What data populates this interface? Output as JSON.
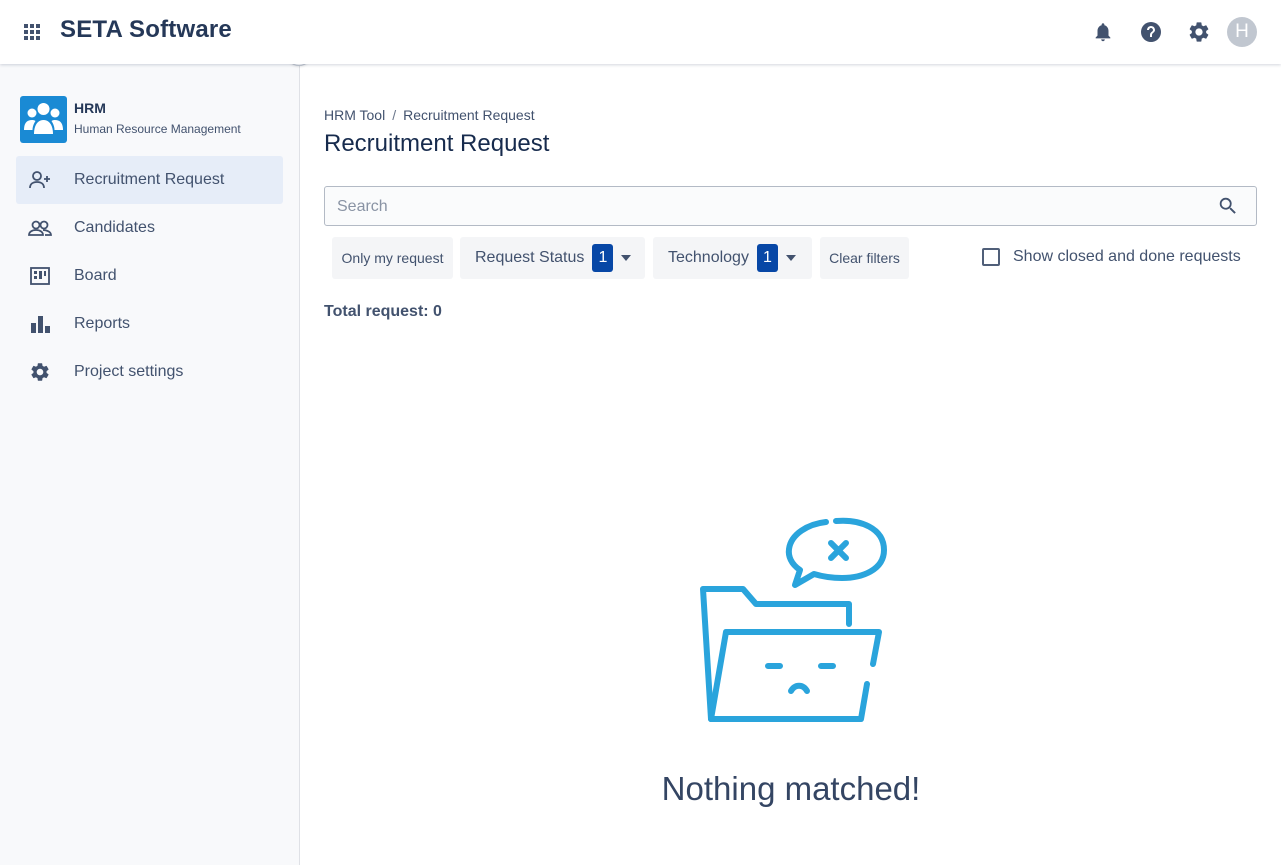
{
  "header": {
    "brand": "SETA Software",
    "avatar_initial": "H",
    "icons": [
      "apps-grid-icon",
      "bell-icon",
      "help-icon",
      "gear-icon"
    ]
  },
  "sidebar": {
    "project_name": "HRM",
    "project_subtitle": "Human Resource Management",
    "items": [
      {
        "label": "Recruitment Request",
        "icon": "add-user-icon",
        "active": true
      },
      {
        "label": "Candidates",
        "icon": "people-icon",
        "active": false
      },
      {
        "label": "Board",
        "icon": "board-icon",
        "active": false
      },
      {
        "label": "Reports",
        "icon": "bar-chart-icon",
        "active": false
      },
      {
        "label": "Project settings",
        "icon": "gear-icon",
        "active": false
      }
    ]
  },
  "main": {
    "breadcrumb": [
      "HRM Tool",
      "Recruitment Request"
    ],
    "breadcrumb_separator": "/",
    "title": "Recruitment Request",
    "search_placeholder": "Search",
    "search_value": "",
    "filters": {
      "only_mine": "Only my request",
      "status_label": "Request Status",
      "status_count": "1",
      "technology_label": "Technology",
      "technology_count": "1",
      "clear": "Clear filters"
    },
    "show_closed_label": "Show closed and done requests",
    "show_closed_checked": false,
    "total_text": "Total request: 0",
    "empty_message": "Nothing matched!"
  },
  "colors": {
    "accent": "#0747a6",
    "illustration": "#2aa4dc",
    "project_logo": "#1a8ad4",
    "active_nav_bg": "#e6edf8"
  }
}
